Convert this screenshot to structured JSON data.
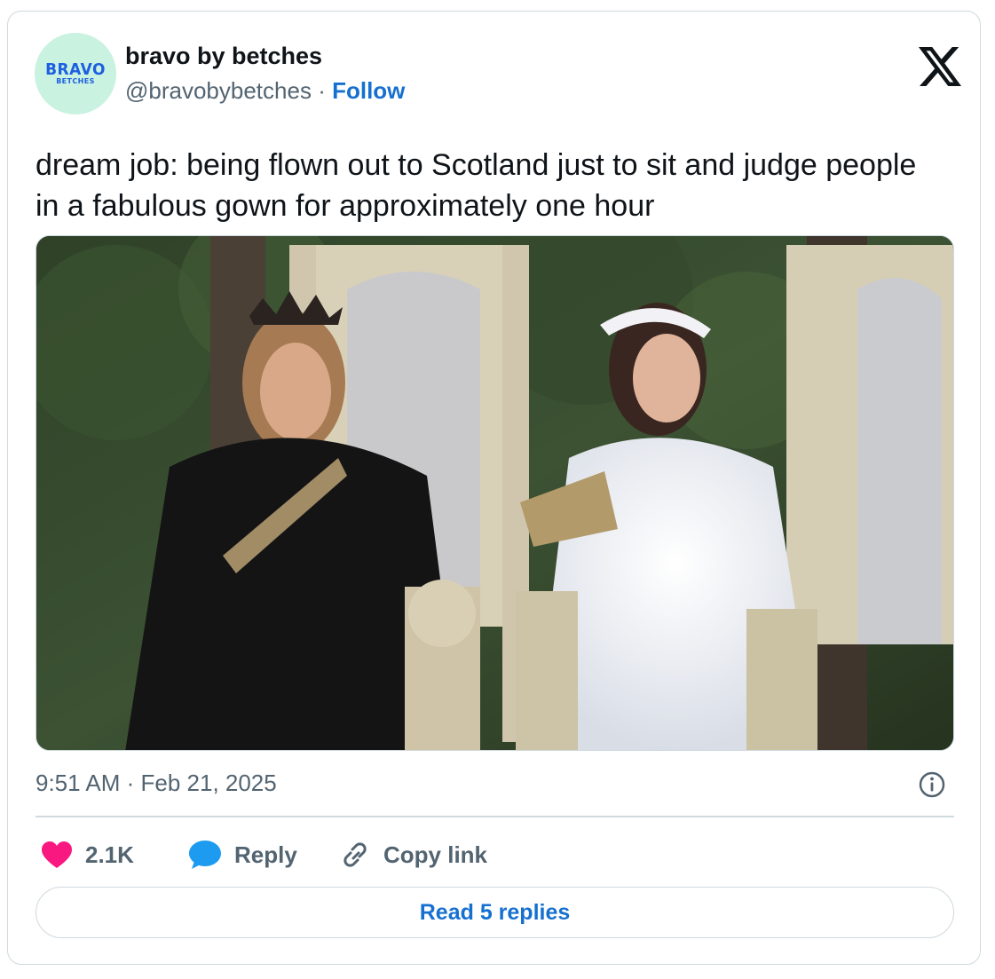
{
  "author": {
    "avatar_text_top": "BRAVO",
    "avatar_text_bottom": "BETCHES",
    "display_name": "bravo by betches",
    "handle": "@bravobybetches",
    "separator": " · ",
    "follow_label": "Follow"
  },
  "platform_icon": "x-logo-icon",
  "tweet": {
    "text": "dream job: being flown out to Scotland just to sit and judge people in a fabulous gown for approximately one hour",
    "media_description_icon": "photo-two-women-on-thrones"
  },
  "meta": {
    "timestamp": "9:51 AM · Feb 21, 2025",
    "info_icon": "info-icon"
  },
  "actions": {
    "like_count": "2.1K",
    "reply_label": "Reply",
    "copy_link_label": "Copy link"
  },
  "read_replies_label": "Read 5 replies",
  "colors": {
    "like": "#f91880",
    "reply": "#1d9bf0",
    "link": "#1670d0",
    "muted": "#536471",
    "border": "#cfd9de",
    "avatar_bg": "#c9f2e1"
  }
}
